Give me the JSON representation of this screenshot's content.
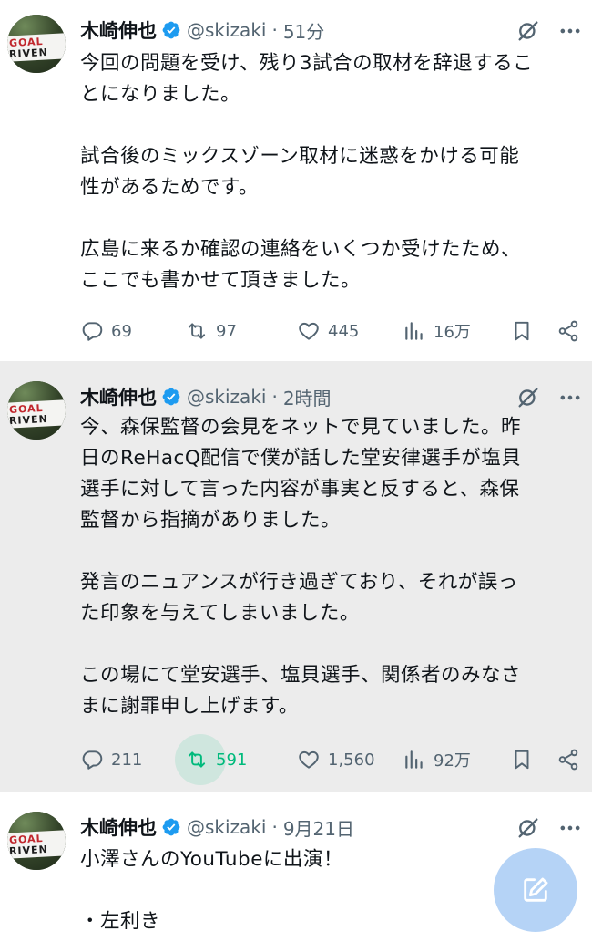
{
  "colors": {
    "verified_blue": "#1d9bf0",
    "retweet_green": "#00ba7c",
    "secondary_text": "#536471",
    "highlight_bg": "#ececec"
  },
  "tweets": [
    {
      "author": {
        "name": "木崎伸也",
        "handle": "@skizaki",
        "avatar_text": [
          "GOAL",
          "RIVEN"
        ]
      },
      "time": "51分",
      "dot": "·",
      "lines": [
        "今回の問題を受け、残り3試合の取材を辞退するこ",
        "とになりました。",
        "",
        "試合後のミックスゾーン取材に迷惑をかける可能",
        "性があるためです。",
        "",
        "広島に来るか確認の連絡をいくつか受けたため、",
        "ここでも書かせて頂きました。"
      ],
      "actions": {
        "replies": "69",
        "retweets": "97",
        "likes": "445",
        "views": "16万"
      }
    },
    {
      "author": {
        "name": "木崎伸也",
        "handle": "@skizaki",
        "avatar_text": [
          "GOAL",
          "RIVEN"
        ]
      },
      "time": "2時間",
      "dot": "·",
      "lines": [
        "今、森保監督の会見をネットで見ていました。昨",
        "日のReHacQ配信で僕が話した堂安律選手が塩貝",
        "選手に対して言った内容が事実と反すると、森保",
        "監督から指摘がありました。",
        "",
        "発言のニュアンスが行き過ぎており、それが誤っ",
        "た印象を与えてしまいました。",
        "",
        "この場にて堂安選手、塩貝選手、関係者のみなさ",
        "まに謝罪申し上げます。"
      ],
      "actions": {
        "replies": "211",
        "retweets": "591",
        "likes": "1,560",
        "views": "92万"
      }
    },
    {
      "author": {
        "name": "木崎伸也",
        "handle": "@skizaki",
        "avatar_text": [
          "GOAL",
          "RIVEN"
        ]
      },
      "time": "9月21日",
      "dot": "·",
      "lines": [
        "小澤さんのYouTubeに出演！",
        "",
        "・左利き"
      ]
    }
  ]
}
